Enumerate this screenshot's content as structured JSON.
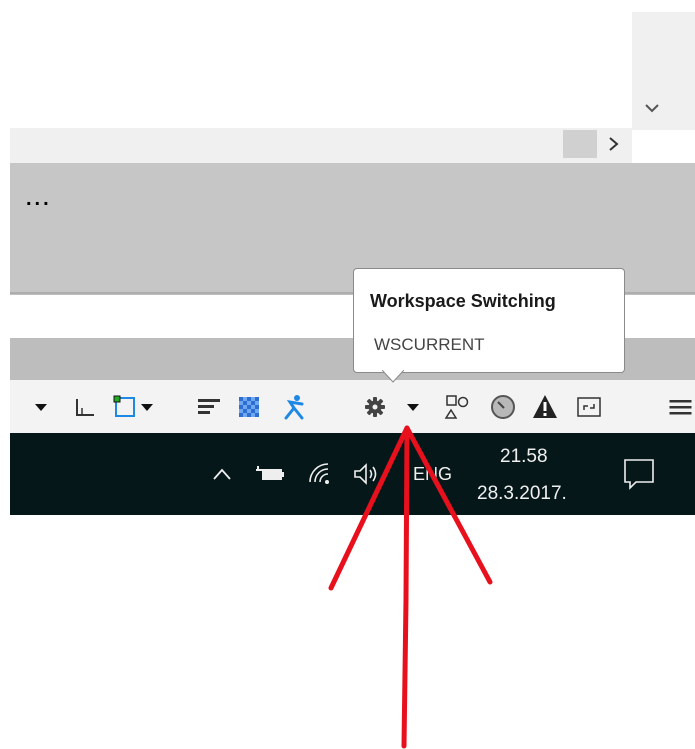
{
  "tooltip": {
    "title": "Workspace Switching",
    "command": "WSCURRENT"
  },
  "panel": {
    "more_label": "..."
  },
  "taskbar": {
    "language": "ENG",
    "time": "21.58",
    "date": "28.3.2017."
  },
  "toolbar_icons": [
    "dropdown-arrow-icon",
    "ortho-mode-icon",
    "selection-box-icon",
    "dropdown-arrow-icon",
    "lineweight-icon",
    "transparency-icon",
    "annotation-scale-icon",
    "workspace-gear-icon",
    "dropdown-arrow-icon",
    "isolate-objects-icon",
    "hardware-acceleration-icon",
    "warning-icon",
    "fullscreen-icon",
    "customization-menu-icon"
  ],
  "tray_icons": [
    "show-hidden-icons",
    "battery-icon",
    "wifi-icon",
    "volume-icon",
    "action-center-icon"
  ],
  "colors": {
    "taskbar": "#06171a",
    "annotation": "#e8101c",
    "accent_blue": "#1e88e5"
  }
}
